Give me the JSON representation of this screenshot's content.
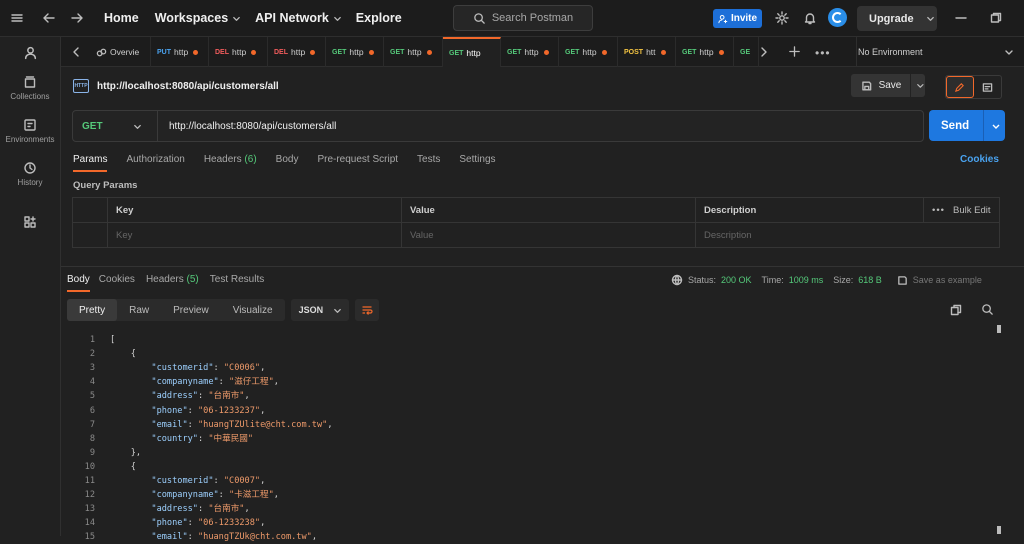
{
  "topbar": {
    "home": "Home",
    "workspaces": "Workspaces",
    "api_network": "API Network",
    "explore": "Explore",
    "search_placeholder": "Search Postman",
    "invite": "Invite",
    "upgrade": "Upgrade"
  },
  "sidebar": {
    "items": [
      {
        "label": ""
      },
      {
        "label": "Collections"
      },
      {
        "label": "Environments"
      },
      {
        "label": "History"
      },
      {
        "label": ""
      }
    ]
  },
  "tabs": [
    {
      "method": "",
      "label": "Overvie",
      "color": "#cfcfcf"
    },
    {
      "method": "PUT",
      "label": "http",
      "color": "#4aa3f0"
    },
    {
      "method": "DEL",
      "label": "http",
      "color": "#f25c5c"
    },
    {
      "method": "DEL",
      "label": "http",
      "color": "#f25c5c"
    },
    {
      "method": "GET",
      "label": "http",
      "color": "#55c97a"
    },
    {
      "method": "GET",
      "label": "http",
      "color": "#55c97a"
    },
    {
      "method": "GET",
      "label": "http",
      "color": "#55c97a"
    },
    {
      "method": "GET",
      "label": "http",
      "color": "#55c97a"
    },
    {
      "method": "GET",
      "label": "http",
      "color": "#55c97a"
    },
    {
      "method": "POST",
      "label": "htt",
      "color": "#f5c542"
    },
    {
      "method": "GET",
      "label": "http",
      "color": "#55c97a"
    },
    {
      "method": "GE",
      "label": "",
      "color": "#55c97a"
    }
  ],
  "environment": "No Environment",
  "request": {
    "title": "http://localhost:8080/api/customers/all",
    "save": "Save",
    "method": "GET",
    "url": "http://localhost:8080/api/customers/all",
    "send": "Send",
    "tabs": {
      "params": "Params",
      "authorization": "Authorization",
      "headers": "Headers",
      "headers_count": "(6)",
      "body": "Body",
      "prescript": "Pre-request Script",
      "tests": "Tests",
      "settings": "Settings"
    },
    "cookies": "Cookies",
    "query_params_title": "Query Params",
    "table": {
      "headers": [
        "Key",
        "Value",
        "Description"
      ],
      "bulk_edit": "Bulk Edit",
      "placeholders": [
        "Key",
        "Value",
        "Description"
      ]
    }
  },
  "response": {
    "tabs": {
      "body": "Body",
      "cookies": "Cookies",
      "headers": "Headers",
      "headers_count": "(5)",
      "test_results": "Test Results"
    },
    "status_label": "Status:",
    "status_value": "200 OK",
    "time_label": "Time:",
    "time_value": "1009 ms",
    "size_label": "Size:",
    "size_value": "618 B",
    "save_example": "Save as example",
    "views": [
      "Pretty",
      "Raw",
      "Preview",
      "Visualize"
    ],
    "format": "JSON",
    "lines": [
      {
        "n": "1",
        "t": "["
      },
      {
        "n": "2",
        "t": "    {"
      },
      {
        "n": "3",
        "k": "\"customerid\"",
        "v": "\"C0006\"",
        "ind": "        "
      },
      {
        "n": "4",
        "k": "\"companyname\"",
        "v": "\"滋仔工程\"",
        "ind": "        "
      },
      {
        "n": "5",
        "k": "\"address\"",
        "v": "\"台南市\"",
        "ind": "        "
      },
      {
        "n": "6",
        "k": "\"phone\"",
        "v": "\"06-1233237\"",
        "ind": "        "
      },
      {
        "n": "7",
        "k": "\"email\"",
        "v": "\"huangTZUlite@cht.com.tw\"",
        "ind": "        "
      },
      {
        "n": "8",
        "k": "\"country\"",
        "v": "\"中華民國\"",
        "ind": "        ",
        "last": true
      },
      {
        "n": "9",
        "t": "    },"
      },
      {
        "n": "10",
        "t": "    {"
      },
      {
        "n": "11",
        "k": "\"customerid\"",
        "v": "\"C0007\"",
        "ind": "        "
      },
      {
        "n": "12",
        "k": "\"companyname\"",
        "v": "\"卡滋工程\"",
        "ind": "        "
      },
      {
        "n": "13",
        "k": "\"address\"",
        "v": "\"台南市\"",
        "ind": "        "
      },
      {
        "n": "14",
        "k": "\"phone\"",
        "v": "\"06-1233238\"",
        "ind": "        "
      },
      {
        "n": "15",
        "k": "\"email\"",
        "v": "\"huangTZUk@cht.com.tw\"",
        "ind": "        "
      }
    ]
  }
}
